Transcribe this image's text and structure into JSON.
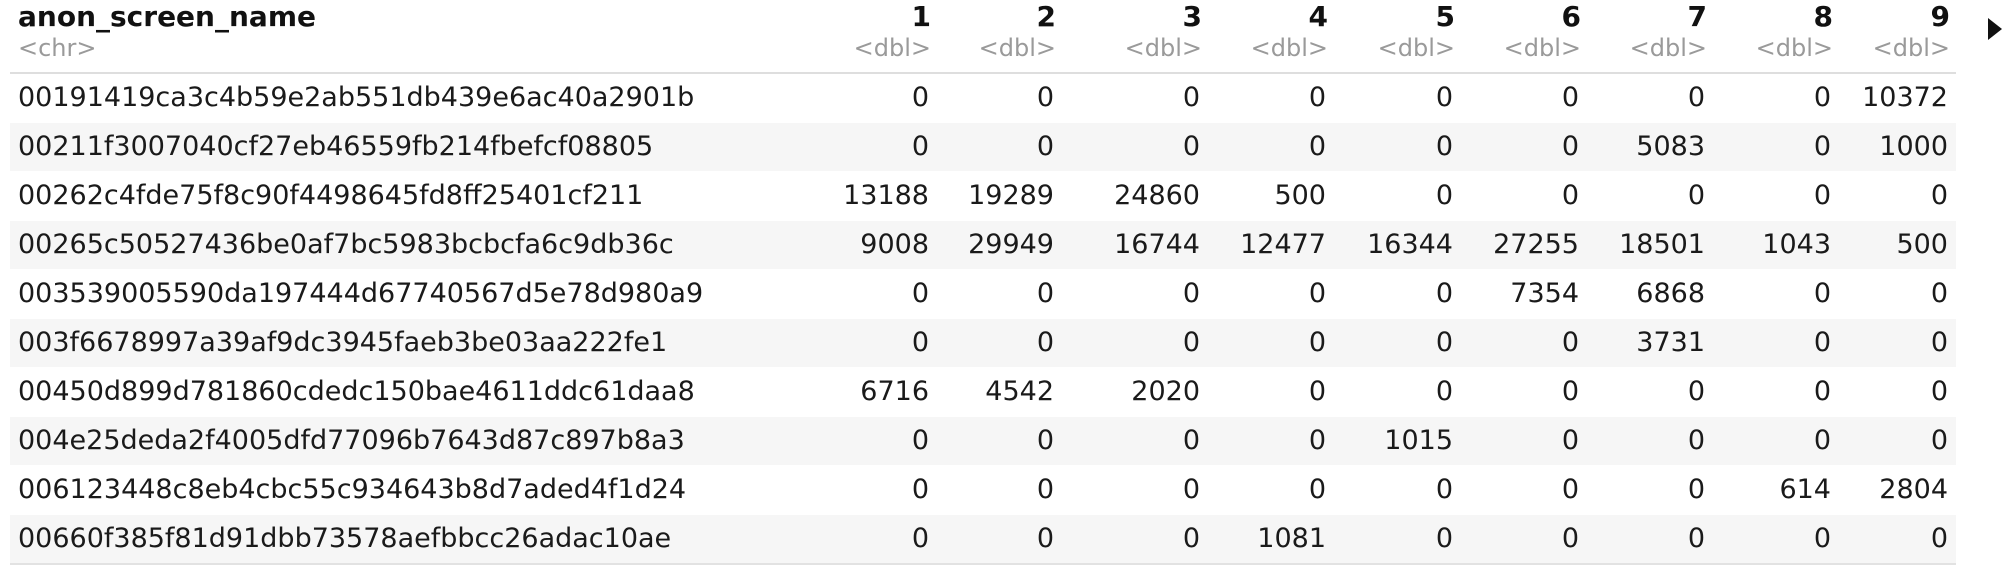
{
  "table": {
    "columns": [
      {
        "name": "anon_screen_name",
        "type": "<chr>"
      },
      {
        "name": "1",
        "type": "<dbl>"
      },
      {
        "name": "2",
        "type": "<dbl>"
      },
      {
        "name": "3",
        "type": "<dbl>"
      },
      {
        "name": "4",
        "type": "<dbl>"
      },
      {
        "name": "5",
        "type": "<dbl>"
      },
      {
        "name": "6",
        "type": "<dbl>"
      },
      {
        "name": "7",
        "type": "<dbl>"
      },
      {
        "name": "8",
        "type": "<dbl>"
      },
      {
        "name": "9",
        "type": "<dbl>"
      }
    ],
    "rows": [
      [
        "00191419ca3c4b59e2ab551db439e6ac40a2901b",
        "0",
        "0",
        "0",
        "0",
        "0",
        "0",
        "0",
        "0",
        "10372"
      ],
      [
        "00211f3007040cf27eb46559fb214fbefcf08805",
        "0",
        "0",
        "0",
        "0",
        "0",
        "0",
        "5083",
        "0",
        "1000"
      ],
      [
        "00262c4fde75f8c90f4498645fd8ff25401cf211",
        "13188",
        "19289",
        "24860",
        "500",
        "0",
        "0",
        "0",
        "0",
        "0"
      ],
      [
        "00265c50527436be0af7bc5983bcbcfa6c9db36c",
        "9008",
        "29949",
        "16744",
        "12477",
        "16344",
        "27255",
        "18501",
        "1043",
        "500"
      ],
      [
        "003539005590da197444d67740567d5e78d980a9",
        "0",
        "0",
        "0",
        "0",
        "0",
        "7354",
        "6868",
        "0",
        "0"
      ],
      [
        "003f6678997a39af9dc3945faeb3be03aa222fe1",
        "0",
        "0",
        "0",
        "0",
        "0",
        "0",
        "3731",
        "0",
        "0"
      ],
      [
        "00450d899d781860cdedc150bae4611ddc61daa8",
        "6716",
        "4542",
        "2020",
        "0",
        "0",
        "0",
        "0",
        "0",
        "0"
      ],
      [
        "004e25deda2f4005dfd77096b7643d87c897b8a3",
        "0",
        "0",
        "0",
        "0",
        "1015",
        "0",
        "0",
        "0",
        "0"
      ],
      [
        "006123448c8eb4cbc55c934643b8d7aded4f1d24",
        "0",
        "0",
        "0",
        "0",
        "0",
        "0",
        "0",
        "614",
        "2804"
      ],
      [
        "00660f385f81d91dbb73578aefbbcc26adac10ae",
        "0",
        "0",
        "0",
        "1081",
        "0",
        "0",
        "0",
        "0",
        "0"
      ]
    ]
  },
  "pager": {
    "next_columns_icon": "triangle-right-icon"
  }
}
